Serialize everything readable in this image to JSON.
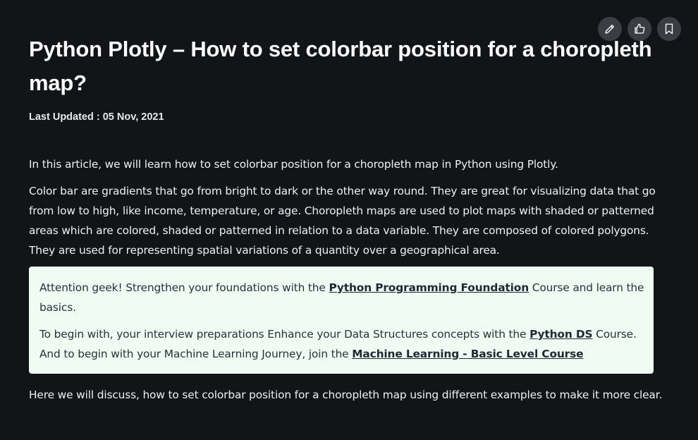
{
  "article": {
    "title": "Python Plotly – How to set colorbar position for a choropleth map?",
    "last_updated": "Last Updated : 05 Nov, 2021",
    "intro": "In this article, we will learn how to set colorbar position for a choropleth map in Python using Plotly.",
    "body": "Color bar are gradients that go from bright to dark or the other way round. They are great for visualizing data that go from low to high, like income, temperature, or age. Choropleth maps are used to plot maps with shaded or patterned areas which are colored, shaded or patterned in relation to a data variable. They are composed of colored polygons. They are used for representing spatial variations of a quantity over a geographical area.",
    "closing": "Here we will discuss, how to set colorbar position for a choropleth map using different examples to make it more clear."
  },
  "callout": {
    "line1_prefix": " Attention geek! Strengthen your foundations with the ",
    "line1_link": "Python Programming Foundation",
    "line1_suffix": " Course and learn the basics.",
    "line2_prefix": "To begin with, your interview preparations Enhance your Data Structures concepts with the ",
    "line2_link": "Python DS",
    "line2_middle": " Course. And to begin with your Machine Learning Journey, join the ",
    "line2_link2": "Machine Learning - Basic Level Course"
  },
  "actions": {
    "icons": [
      "edit-icon",
      "like-icon",
      "bookmark-icon"
    ]
  },
  "colors": {
    "background": "#131417",
    "callout_bg": "#f0fbf4",
    "icon_bg": "#3b3d42"
  }
}
